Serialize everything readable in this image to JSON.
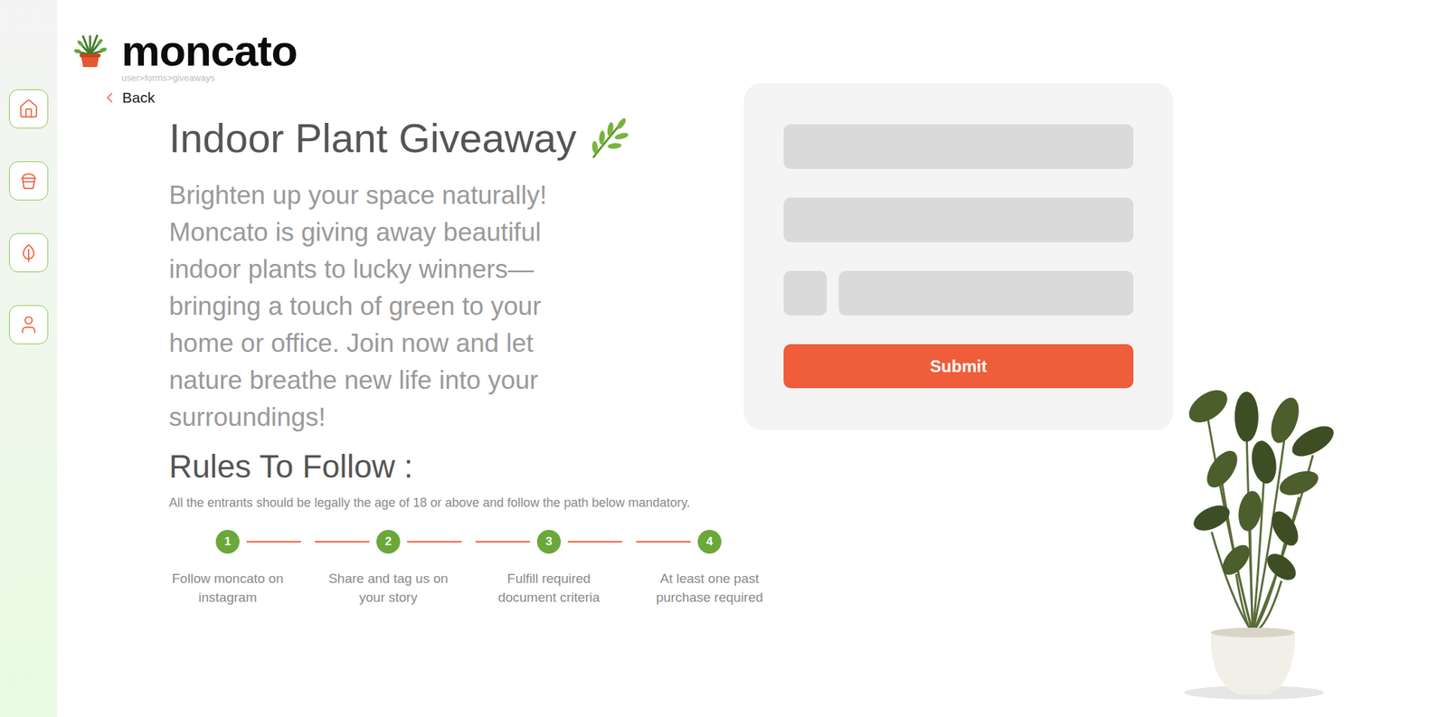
{
  "brand": {
    "name": "moncato"
  },
  "breadcrumb": "user>forms>giveaways",
  "sidebar": {
    "items": [
      {
        "kind": "home",
        "selected": false
      },
      {
        "kind": "pot",
        "selected": false
      },
      {
        "kind": "leaf",
        "selected": false
      },
      {
        "kind": "user",
        "selected": false
      }
    ]
  },
  "back": "Back",
  "title": "Indoor Plant Giveaway",
  "description": "Brighten up your space naturally! Moncato is giving away beautiful indoor plants to lucky winners—bringing a touch of green to your home or office. Join now and let nature breathe new life into your surroundings!",
  "rules": {
    "title": "Rules To Follow :",
    "note": "All the entrants should be legally the age of 18 or above and follow the path below mandatory.",
    "steps": [
      {
        "number": "1",
        "label": "Follow moncato on instagram"
      },
      {
        "number": "2",
        "label": "Share and tag us on your story"
      },
      {
        "number": "3",
        "label": "Fulfill required document criteria"
      },
      {
        "number": "4",
        "label": "At least one past purchase required"
      }
    ]
  },
  "form": {
    "fields": [
      {
        "kind": "full"
      },
      {
        "kind": "full"
      },
      {
        "kind": "phone"
      }
    ],
    "submit": "Submit"
  }
}
